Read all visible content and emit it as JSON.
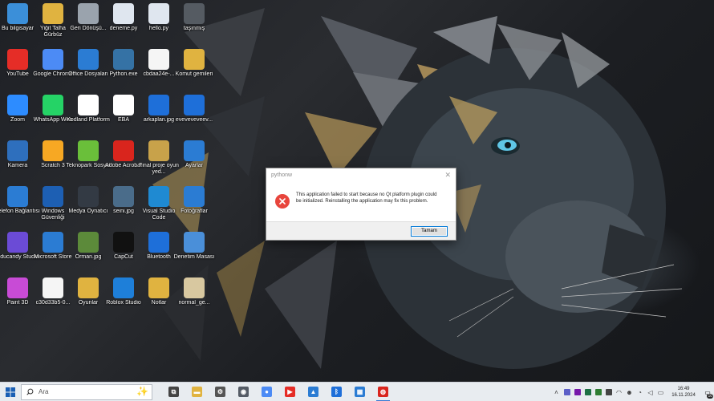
{
  "desktop": {
    "icons": [
      {
        "label": "Bu bilgisayar",
        "icon": "this-pc-icon",
        "color": "#3b8fd9"
      },
      {
        "label": "Yiğit Talha Gürbüz",
        "icon": "user-folder-icon",
        "color": "#e0b340"
      },
      {
        "label": "Geri Dönüşü...",
        "icon": "recycle-bin-icon",
        "color": "#9aa3ad"
      },
      {
        "label": "deneme.py",
        "icon": "python-file-icon",
        "color": "#dfe6ef"
      },
      {
        "label": "hello.py",
        "icon": "python-file-icon",
        "color": "#dfe6ef"
      },
      {
        "label": "taşınmış",
        "icon": "folder-icon",
        "color": "#555b62"
      },
      {
        "label": "YouTube",
        "icon": "youtube-icon",
        "color": "#e52d27"
      },
      {
        "label": "Google Chrome",
        "icon": "chrome-icon",
        "color": "#4c8bf5"
      },
      {
        "label": "Office Dosyaları",
        "icon": "onedrive-icon",
        "color": "#2b7cd3"
      },
      {
        "label": "Python.exe",
        "icon": "python-exe-icon",
        "color": "#3572a5"
      },
      {
        "label": "cbdaa24e-...",
        "icon": "blank-file-icon",
        "color": "#f5f5f5"
      },
      {
        "label": "Komut gemileri",
        "icon": "folder-icon",
        "color": "#e0b340"
      },
      {
        "label": "Zoom",
        "icon": "zoom-icon",
        "color": "#2d8cff"
      },
      {
        "label": "WhatsApp Web",
        "icon": "whatsapp-icon",
        "color": "#25d366"
      },
      {
        "label": "Kodland Platform",
        "icon": "kodland-icon",
        "color": "#ffffff"
      },
      {
        "label": "EBA",
        "icon": "eba-icon",
        "color": "#ffffff"
      },
      {
        "label": "arkaplan.jpg",
        "icon": "image-file-icon",
        "color": "#1e6fd9"
      },
      {
        "label": "eveveveveev...",
        "icon": "windows-image-icon",
        "color": "#1e6fd9"
      },
      {
        "label": "Kamera",
        "icon": "camera-icon",
        "color": "#2e6fbd"
      },
      {
        "label": "Scratch 3",
        "icon": "scratch-icon",
        "color": "#f7a823"
      },
      {
        "label": "Teknopark Sosyal",
        "icon": "teknopark-icon",
        "color": "#6abf3a"
      },
      {
        "label": "Adobe Acrobat",
        "icon": "acrobat-icon",
        "color": "#d9251d"
      },
      {
        "label": "Final proje oyun yed...",
        "icon": "archive-icon",
        "color": "#c8a24a"
      },
      {
        "label": "Ayarlar",
        "icon": "settings-icon",
        "color": "#2b7cd3"
      },
      {
        "label": "Telefon Bağlantısı",
        "icon": "phone-link-icon",
        "color": "#2b7cd3"
      },
      {
        "label": "Windows Güvenliği",
        "icon": "shield-icon",
        "color": "#1d5fb3"
      },
      {
        "label": "Medya Oynatıcı",
        "icon": "media-player-icon",
        "color": "#333a44"
      },
      {
        "label": "seini.jpg",
        "icon": "image-file-icon",
        "color": "#4a6c8a"
      },
      {
        "label": "Visual Studio Code",
        "icon": "vscode-icon",
        "color": "#1f8ad2"
      },
      {
        "label": "Fotoğraflar",
        "icon": "photos-icon",
        "color": "#2b7cd3"
      },
      {
        "label": "Educandy Studio",
        "icon": "educandy-icon",
        "color": "#6b4bd6"
      },
      {
        "label": "Microsoft Store",
        "icon": "store-icon",
        "color": "#2b7cd3"
      },
      {
        "label": "Orman.jpg",
        "icon": "image-file-icon",
        "color": "#5c8a3a"
      },
      {
        "label": "CapCut",
        "icon": "capcut-icon",
        "color": "#111111"
      },
      {
        "label": "Bluetooth",
        "icon": "bluetooth-icon",
        "color": "#1e6fd9"
      },
      {
        "label": "Denetim Masası",
        "icon": "control-panel-icon",
        "color": "#4a8fd9"
      },
      {
        "label": "Paint 3D",
        "icon": "paint3d-icon",
        "color": "#c84bd6"
      },
      {
        "label": "c30d33b5-0...",
        "icon": "blank-file-icon",
        "color": "#f5f5f5"
      },
      {
        "label": "Oyunlar",
        "icon": "folder-icon",
        "color": "#e0b340"
      },
      {
        "label": "Roblox Studio",
        "icon": "roblox-icon",
        "color": "#1e7fd9"
      },
      {
        "label": "Notlar",
        "icon": "folder-icon",
        "color": "#e0b340"
      },
      {
        "label": "normal_ge...",
        "icon": "file-icon",
        "color": "#d8c8a0"
      }
    ]
  },
  "dialog": {
    "title": "pythonw",
    "close_glyph": "✕",
    "message": "This application failed to start because no Qt platform plugin could be initialized. Reinstalling the application may fix this problem.",
    "ok_label": "Tamam",
    "icon": "error-icon",
    "icon_color": "#e8453c"
  },
  "taskbar": {
    "search_placeholder": "Ara",
    "apps": [
      {
        "name": "task-view-icon",
        "color": "#444444",
        "glyph": "⧉"
      },
      {
        "name": "file-explorer-icon",
        "color": "#e0b340",
        "glyph": "▬"
      },
      {
        "name": "settings-icon",
        "color": "#555555",
        "glyph": "⚙"
      },
      {
        "name": "camera-icon",
        "color": "#555c66",
        "glyph": "◉"
      },
      {
        "name": "chrome-icon",
        "color": "#4c8bf5",
        "glyph": "●"
      },
      {
        "name": "youtube-icon",
        "color": "#e52d27",
        "glyph": "▶"
      },
      {
        "name": "photos-icon",
        "color": "#2b7cd3",
        "glyph": "▲"
      },
      {
        "name": "bluetooth-icon",
        "color": "#1e6fd9",
        "glyph": "ᛒ"
      },
      {
        "name": "store-icon",
        "color": "#2b7cd3",
        "glyph": "▦"
      },
      {
        "name": "python-error-icon",
        "color": "#d9251d",
        "glyph": "◍"
      }
    ],
    "tray": [
      {
        "name": "chevron-up-icon",
        "glyph": "˄",
        "color": "#333333"
      },
      {
        "name": "teams-icon",
        "glyph": "",
        "color": "#5b5fc7"
      },
      {
        "name": "onenote-icon",
        "glyph": "",
        "color": "#7719aa"
      },
      {
        "name": "excel-icon",
        "glyph": "",
        "color": "#1d7044"
      },
      {
        "name": "security-icon",
        "glyph": "",
        "color": "#2e7d32"
      },
      {
        "name": "app-icon",
        "glyph": "",
        "color": "#444444"
      },
      {
        "name": "network-icon",
        "glyph": "◠",
        "color": "#333333"
      },
      {
        "name": "people-icon",
        "glyph": "☻",
        "color": "#333333"
      },
      {
        "name": "wifi-icon",
        "glyph": "◔",
        "color": "#333333"
      },
      {
        "name": "volume-icon",
        "glyph": "◁",
        "color": "#333333"
      },
      {
        "name": "battery-icon",
        "glyph": "▭",
        "color": "#333333"
      }
    ],
    "time": "16:49",
    "date": "16.11.2024",
    "notification_count": "10"
  }
}
